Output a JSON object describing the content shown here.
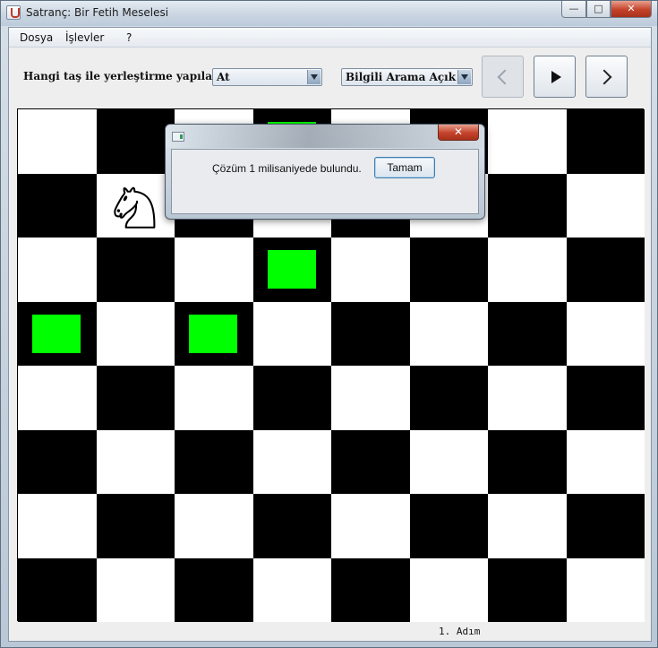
{
  "window": {
    "title": "Satranç: Bir Fetih Meselesi",
    "min_label": "—",
    "max_label": "□",
    "close_label": "✕"
  },
  "menu": [
    "Dosya",
    "İşlevler",
    "?"
  ],
  "toolbar": {
    "piece_label": "Hangi taş ile yerleştirme yapılacak?",
    "piece_value": "At",
    "search_value": "Bilgili Arama Açık"
  },
  "board": {
    "rows": 8,
    "cols": 8,
    "colors": {
      "dark": "#000000",
      "light": "#ffffff",
      "highlight": "#00ff00"
    },
    "knight": {
      "row": 1,
      "col": 1
    },
    "highlights": [
      {
        "row": 0,
        "col": 3
      },
      {
        "row": 2,
        "col": 3
      },
      {
        "row": 3,
        "col": 0
      },
      {
        "row": 3,
        "col": 2
      }
    ]
  },
  "status": "1. Adım",
  "dialog": {
    "message": "Çözüm 1 milisaniyede bulundu.",
    "ok_label": "Tamam",
    "close_label": "✕"
  }
}
